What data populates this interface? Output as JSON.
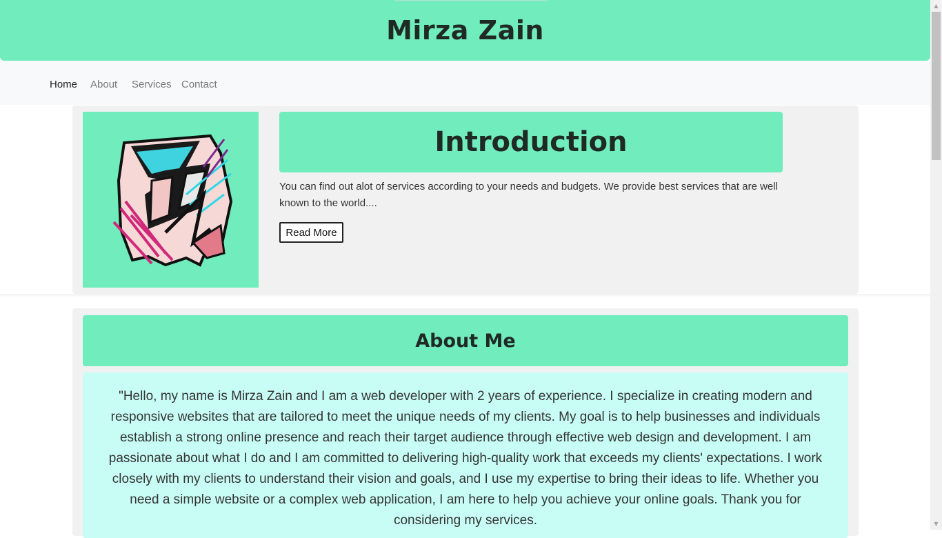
{
  "header": {
    "title": "Mirza Zain"
  },
  "nav": {
    "items": [
      "Home",
      "About",
      "Services",
      "Contact"
    ],
    "active": "Home"
  },
  "intro": {
    "title": "Introduction",
    "text": "You can find out alot of services according to your needs and budgets. We provide best services that are well known to the world....",
    "button_label": "Read More",
    "image_icon": "abstract-logo-icon"
  },
  "about": {
    "title": "About Me",
    "text": "\"Hello, my name is Mirza Zain and I am a web developer with 2 years of experience. I specialize in creating modern and responsive websites that are tailored to meet the unique needs of my clients. My goal is to help businesses and individuals establish a strong online presence and reach their target audience through effective web design and development. I am passionate about what I do and I am committed to delivering high-quality work that exceeds my clients' expectations. I work closely with my clients to understand their vision and goals, and I use my expertise to bring their ideas to life. Whether you need a simple website or a complex web application, I am here to help you achieve your online goals. Thank you for considering my services."
  },
  "colors": {
    "accent": "#70ecbd",
    "about_body_bg": "#c8fdf5",
    "card_bg": "#f1f1f1",
    "nav_bg": "#f8f9fa"
  }
}
